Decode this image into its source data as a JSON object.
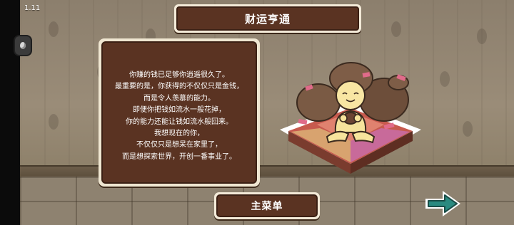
{
  "status_bar": {
    "time": "1.11"
  },
  "title": "财运亨通",
  "story": {
    "lines": [
      "你赚的钱已足够你逍遥很久了。",
      "最重要的是，你获得的不仅仅只是金钱，",
      "而是令人羡慕的能力。",
      "即便你把钱如流水一般花掉，",
      "你的能力还能让钱如流水般回来。",
      "我想现在的你，",
      "不仅仅只是想呆在家里了，",
      "而是想探索世界，开创一番事业了。"
    ]
  },
  "main_menu_button": {
    "label": "主菜单"
  },
  "icons": {
    "next": "arrow-right-icon",
    "screen_record": "camera-icon",
    "illustration": "money-bags-character-illustration"
  },
  "colors": {
    "panel_brown": "#5a3322",
    "panel_border": "#3b2014",
    "panel_frame": "#f3ead8",
    "arrow_teal": "#2a8a80"
  }
}
